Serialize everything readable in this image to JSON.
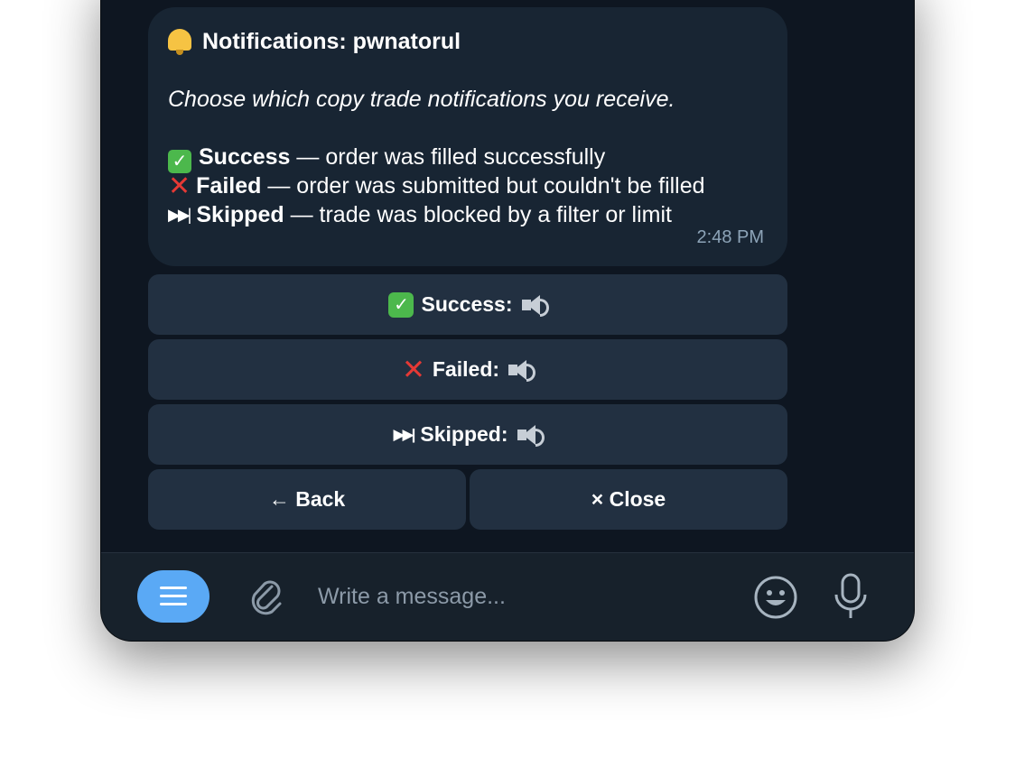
{
  "message": {
    "title": "Notifications: pwnatorul",
    "subtitle": "Choose which copy trade notifications you receive.",
    "items": [
      {
        "icon": "check-mark-icon",
        "label": "Success",
        "desc": "— order was filled successfully"
      },
      {
        "icon": "cross-mark-icon",
        "label": "Failed",
        "desc": "— order was submitted but couldn't be filled"
      },
      {
        "icon": "skip-forward-icon",
        "label": "Skipped",
        "desc": "— trade was blocked by a filter or limit"
      }
    ],
    "time": "2:48 PM"
  },
  "keyboard": {
    "success": "Success:",
    "failed": "Failed:",
    "skipped": "Skipped:",
    "back": "← Back",
    "close": "× Close"
  },
  "composer": {
    "placeholder": "Write a message..."
  },
  "colors": {
    "accent": "#5aa9f5",
    "background": "#0e1621",
    "bubble": "#182533",
    "button": "#223041"
  }
}
